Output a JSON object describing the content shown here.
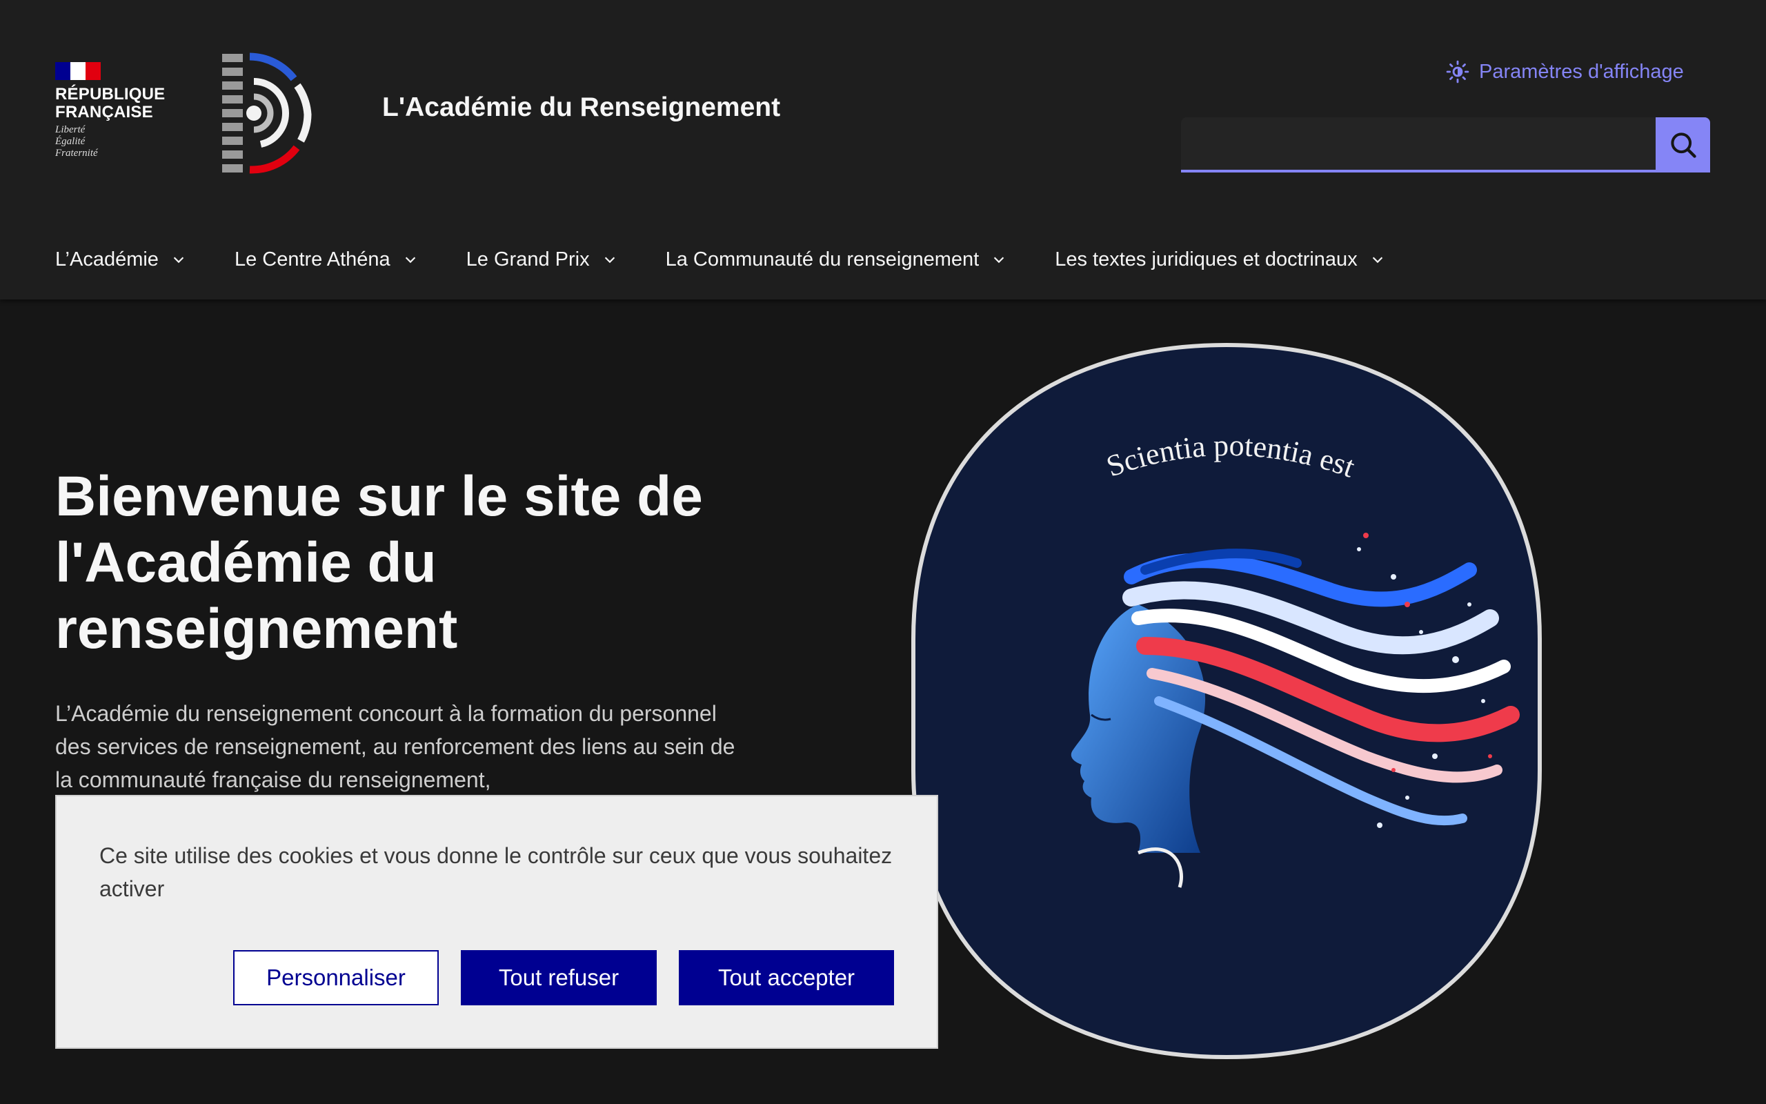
{
  "header": {
    "republic": {
      "name_line1": "République",
      "name_line2": "Française",
      "motto": [
        "Liberté",
        "Égalité",
        "Fraternité"
      ]
    },
    "site_title": "L'Académie du Renseignement",
    "display_settings_label": "Paramètres d'affichage",
    "search": {
      "value": "",
      "placeholder": "",
      "button_label": "Rechercher"
    }
  },
  "nav": {
    "items": [
      {
        "label": "L’Académie"
      },
      {
        "label": "Le Centre Athéna"
      },
      {
        "label": "Le Grand Prix"
      },
      {
        "label": "La Communauté du renseignement"
      },
      {
        "label": "Les textes juridiques et doctrinaux"
      }
    ]
  },
  "hero": {
    "title": "Bienvenue sur le site de l'Académie du renseignement",
    "text": "L’Académie du renseignement concourt à la formation du personnel des services de renseignement, au renforcement des liens au sein de la communauté française du renseignement,",
    "medallion_motto": "Scientia potentia est"
  },
  "cookie_banner": {
    "text": "Ce site utilise des cookies et vous donne le contrôle sur ceux que vous souhaitez activer",
    "customize_label": "Personnaliser",
    "refuse_label": "Tout refuser",
    "accept_label": "Tout accepter"
  },
  "colors": {
    "accent": "#8585f6",
    "primary_button": "#000091",
    "background": "#161616",
    "header_background": "#1e1e1e",
    "flag_blue": "#000091",
    "flag_red": "#e1000f",
    "medallion_background": "#0f1b3a"
  },
  "icons": {
    "display_settings": "sun-icon",
    "search": "search-icon",
    "nav_chevron": "chevron-down-icon"
  }
}
